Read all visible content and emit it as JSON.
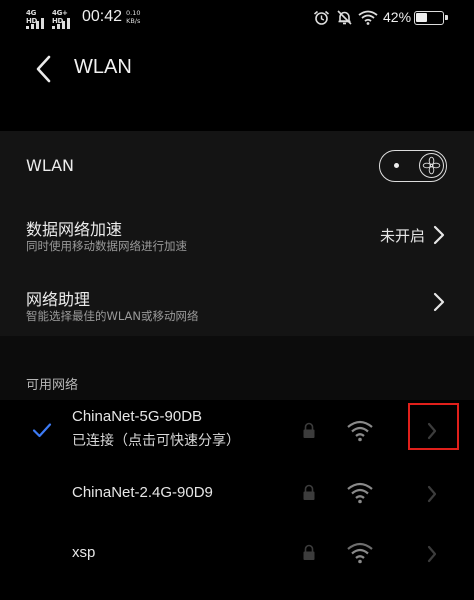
{
  "status_bar": {
    "sim1": "4G HD",
    "sim2": "4G+ HD",
    "time": "00:42",
    "speed_value": "0.10",
    "speed_unit": "KB/s",
    "battery_percent": "42%",
    "battery_level": 0.42,
    "icons": [
      "alarm-icon",
      "mute-bell-icon",
      "wifi-icon",
      "battery-icon"
    ]
  },
  "header": {
    "title": "WLAN"
  },
  "settings": {
    "wlan": {
      "label": "WLAN",
      "enabled": true
    },
    "acceleration": {
      "label": "数据网络加速",
      "sub": "同时使用移动数据网络进行加速",
      "value": "未开启"
    },
    "assistant": {
      "label": "网络助理",
      "sub": "智能选择最佳的WLAN或移动网络"
    }
  },
  "section_title": "可用网络",
  "networks": [
    {
      "ssid": "ChinaNet-5G-90DB",
      "status": "已连接（点击可快速分享）",
      "connected": true,
      "secured": true
    },
    {
      "ssid": "ChinaNet-2.4G-90D9",
      "connected": false,
      "secured": true
    },
    {
      "ssid": "xsp",
      "connected": false,
      "secured": true
    }
  ],
  "colors": {
    "accent": "#3d7bf5",
    "highlight_box": "#e0201b"
  }
}
